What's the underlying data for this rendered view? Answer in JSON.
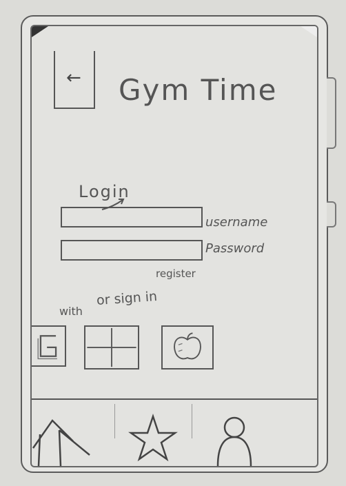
{
  "header": {
    "title": "Gym Time",
    "back_icon": "arrow-left-icon"
  },
  "login": {
    "heading": "Login",
    "username_label": "username",
    "password_label": "Password",
    "register_label": "register",
    "alt_signin_label": "or sign in",
    "with_label": "with"
  },
  "social": [
    {
      "name": "google-icon"
    },
    {
      "name": "microsoft-icon"
    },
    {
      "name": "apple-icon"
    }
  ],
  "nav": [
    {
      "name": "home-icon"
    },
    {
      "name": "star-icon"
    },
    {
      "name": "profile-icon"
    }
  ]
}
